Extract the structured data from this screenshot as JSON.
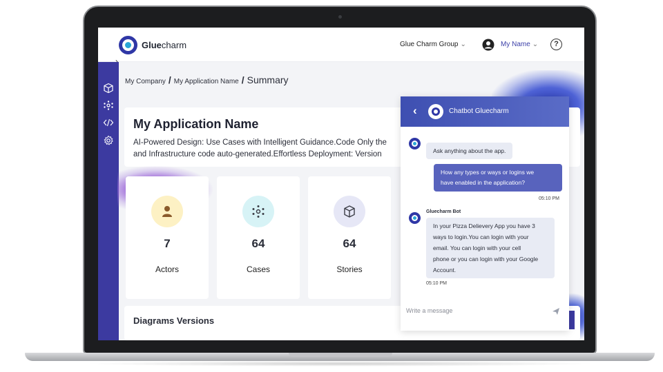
{
  "brand": {
    "logo_strong": "Glue",
    "logo_light": "charm"
  },
  "topbar": {
    "org_name": "Glue Charm Group",
    "user_name": "My Name",
    "help": "?"
  },
  "sidebar": {
    "items": [
      {
        "icon": "cube-icon"
      },
      {
        "icon": "network-icon"
      },
      {
        "icon": "code-icon"
      },
      {
        "icon": "gear-icon"
      }
    ]
  },
  "breadcrumb": {
    "company": "My Company",
    "application": "My Application Name",
    "current": "Summary",
    "separator": "/"
  },
  "app": {
    "title": "My Application Name",
    "description": "AI-Powered Design: Use Cases with Intelligent Guidance.Code Only the",
    "description_line2": "and Infrastructure code auto-generated.Effortless Deployment: Version"
  },
  "stats": [
    {
      "label": "Actors",
      "value": "7",
      "icon": "person-icon",
      "bg": "#fdf1c4",
      "fg": "#8a5a2b"
    },
    {
      "label": "Cases",
      "value": "64",
      "icon": "network-icon",
      "bg": "#d7f3f6",
      "fg": "#3a3c45"
    },
    {
      "label": "Stories",
      "value": "64",
      "icon": "cube-icon",
      "bg": "#e6e7f6",
      "fg": "#3a3c45"
    }
  ],
  "diagrams": {
    "title": "Diagrams Versions"
  },
  "chat": {
    "title": "Chatbot Gluecharm",
    "greeting": "Ask anything about the app.",
    "user_message_line1": "How any types or ways or logins we",
    "user_message_line2": "have enabled in the application?",
    "user_time": "05:10 PM",
    "bot_name": "Gluecharm Bot",
    "bot_reply_lines": [
      "In your Pizza Delievery App you have 3",
      "ways to login.You can login with your",
      "email. You can login with your cell",
      "phone or you can login with your Google",
      "Account."
    ],
    "bot_time": "05:10 PM",
    "input_placeholder": "Write a message"
  },
  "colors": {
    "sidebar": "#3c3aa0",
    "accent": "#2f37a6",
    "chat_header": "#4a5bbd",
    "user_bubble": "#5863bd"
  }
}
